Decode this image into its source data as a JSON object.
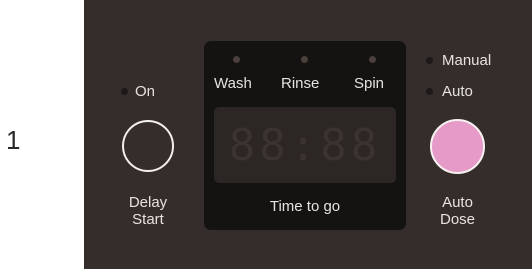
{
  "step": {
    "number": "1"
  },
  "panel": {
    "on_label": "On",
    "delay_start": {
      "line1": "Delay",
      "line2": "Start"
    },
    "cycles": [
      "Wash",
      "Rinse",
      "Spin"
    ],
    "display": {
      "digits": "88:88",
      "caption": "Time to go"
    },
    "modes": {
      "manual": "Manual",
      "auto": "Auto"
    },
    "auto_dose": {
      "line1": "Auto",
      "line2": "Dose"
    },
    "colors": {
      "panel": "#342d2b",
      "display": "#151312",
      "screen": "#2c2624",
      "auto_dose_button": "#e69ac8",
      "text": "#e6e2df"
    }
  }
}
